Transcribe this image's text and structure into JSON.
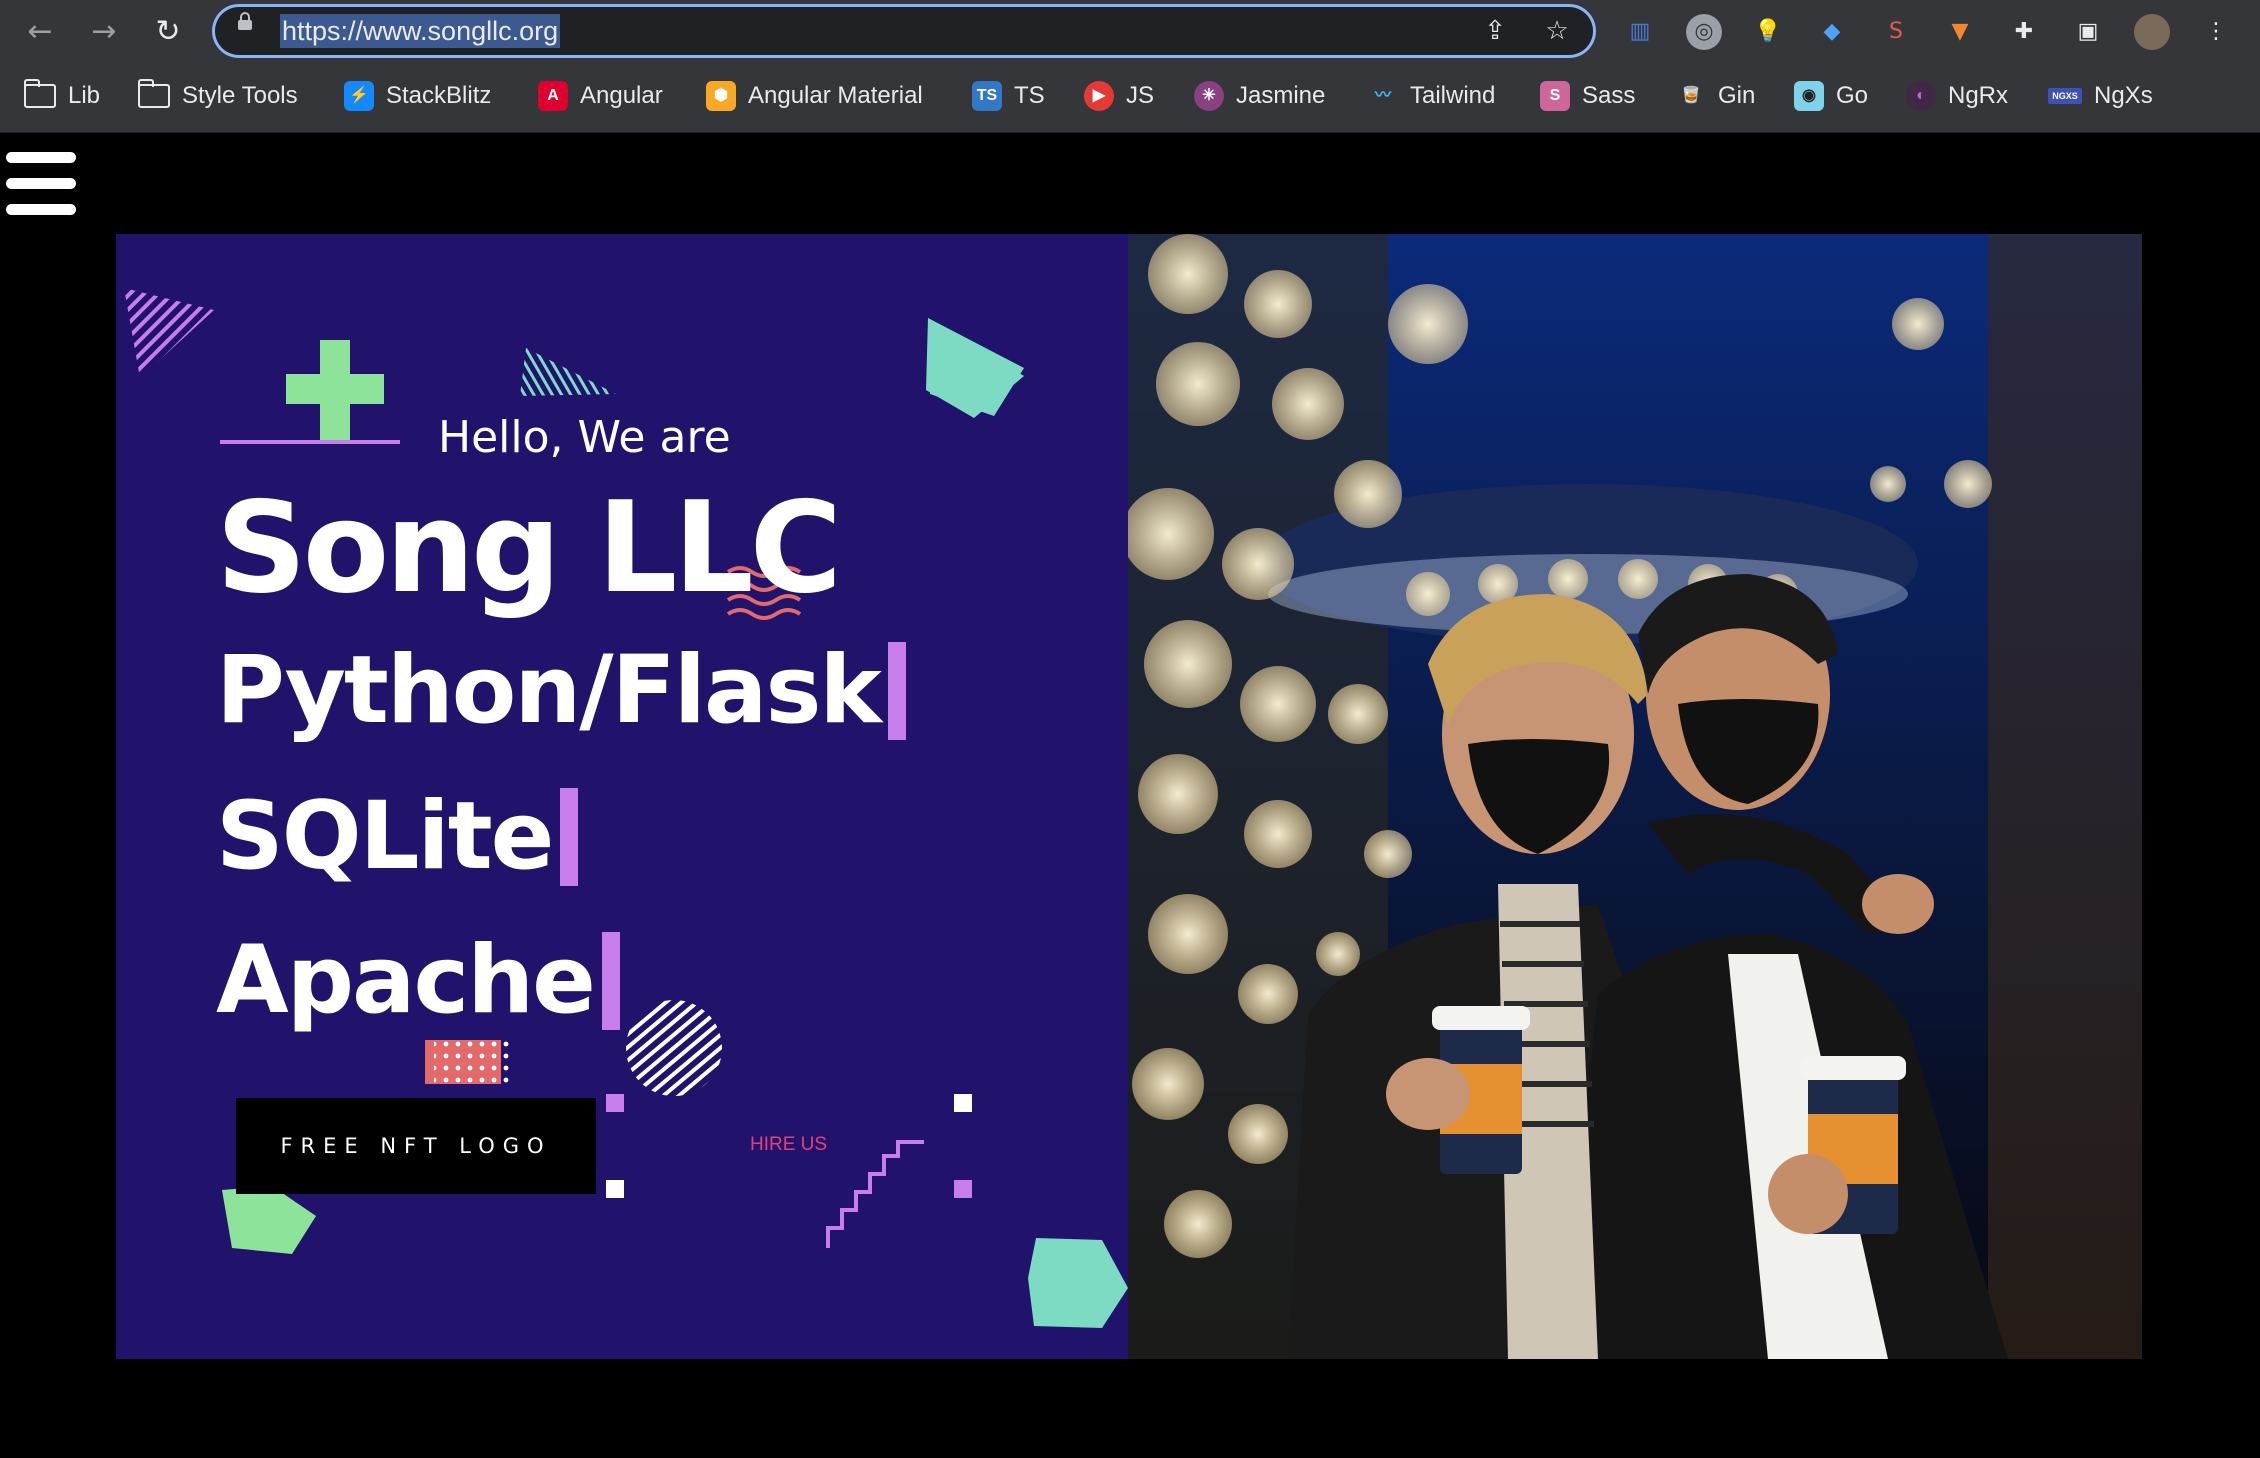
{
  "browser": {
    "url": "https://www.songllc.org",
    "bookmarks": [
      {
        "label": "Lib",
        "icon": "folder-icon"
      },
      {
        "label": "Style Tools",
        "icon": "folder-icon"
      },
      {
        "label": "StackBlitz",
        "icon": "stackblitz-icon"
      },
      {
        "label": "Angular",
        "icon": "angular-icon"
      },
      {
        "label": "Angular Material",
        "icon": "angular-material-icon"
      },
      {
        "label": "TS",
        "icon": "typescript-icon"
      },
      {
        "label": "JS",
        "icon": "javascript-icon"
      },
      {
        "label": "Jasmine",
        "icon": "jasmine-icon"
      },
      {
        "label": "Tailwind",
        "icon": "tailwind-icon"
      },
      {
        "label": "Sass",
        "icon": "sass-icon"
      },
      {
        "label": "Gin",
        "icon": "gin-icon"
      },
      {
        "label": "Go",
        "icon": "go-icon"
      },
      {
        "label": "NgRx",
        "icon": "ngrx-icon"
      },
      {
        "label": "NgXs",
        "icon": "ngxs-icon"
      }
    ]
  },
  "hero": {
    "greeting": "Hello, We are",
    "brand": "Song LLC",
    "tech": [
      "Python/Flask",
      "SQLite",
      "Apache"
    ],
    "primary_button": "FREE NFT LOGO",
    "secondary_link": "HIRE US"
  },
  "colors": {
    "hero_bg": "#21136c",
    "accent_purple": "#c77dea",
    "accent_green": "#8ee39a",
    "accent_teal": "#7ddbc4",
    "accent_pink": "#e5407a",
    "accent_coral": "#e26a6a"
  }
}
